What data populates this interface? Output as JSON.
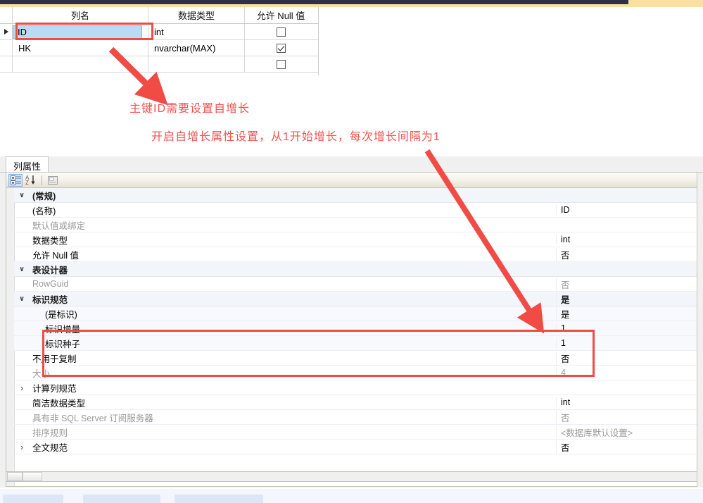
{
  "grid": {
    "headers": [
      "",
      "列名",
      "数据类型",
      "允许 Null 值"
    ],
    "rows": [
      {
        "marker": "▶",
        "name": "ID",
        "type": "int",
        "nullable": false,
        "selected": true
      },
      {
        "marker": "",
        "name": "HK",
        "type": "nvarchar(MAX)",
        "nullable": true,
        "selected": false
      },
      {
        "marker": "",
        "name": "",
        "type": "",
        "nullable": false,
        "selected": false
      }
    ]
  },
  "annotations": {
    "line1": "主键ID需要设置自增长",
    "line2": "开启自增长属性设置，从1开始增长，每次增长间隔为1",
    "color": "#f2534f",
    "box_color": "#f04b45"
  },
  "properties_panel": {
    "tab_label": "列属性",
    "toolbar": {
      "categorized_title": "按类别分组",
      "alphabetical_title": "字母序",
      "property_pages_title": "属性页"
    },
    "rows": [
      {
        "kind": "category",
        "expander": "down",
        "label": "(常规)",
        "value": ""
      },
      {
        "kind": "item",
        "expander": "",
        "label": "(名称)",
        "value": "ID"
      },
      {
        "kind": "item",
        "expander": "",
        "label": "默认值或绑定",
        "value": "",
        "dim": true
      },
      {
        "kind": "item",
        "expander": "",
        "label": "数据类型",
        "value": "int"
      },
      {
        "kind": "item",
        "expander": "",
        "label": "允许 Null 值",
        "value": "否"
      },
      {
        "kind": "category",
        "expander": "down",
        "label": "表设计器",
        "value": ""
      },
      {
        "kind": "item",
        "expander": "",
        "label": "RowGuid",
        "value": "否",
        "dim": true
      },
      {
        "kind": "category",
        "expander": "down",
        "label": "标识规范",
        "value": "是"
      },
      {
        "kind": "sub",
        "expander": "",
        "label": "(是标识)",
        "value": "是"
      },
      {
        "kind": "sub",
        "expander": "",
        "label": "标识增量",
        "value": "1"
      },
      {
        "kind": "sub",
        "expander": "",
        "label": "标识种子",
        "value": "1"
      },
      {
        "kind": "item",
        "expander": "",
        "label": "不用于复制",
        "value": "否"
      },
      {
        "kind": "item",
        "expander": "",
        "label": "大小",
        "value": "4",
        "dim": true
      },
      {
        "kind": "item",
        "expander": "right",
        "label": "计算列规范",
        "value": ""
      },
      {
        "kind": "item",
        "expander": "",
        "label": "简洁数据类型",
        "value": "int"
      },
      {
        "kind": "item",
        "expander": "",
        "label": "具有非 SQL Server 订阅服务器",
        "value": "否",
        "dim": true
      },
      {
        "kind": "item",
        "expander": "",
        "label": "排序规则",
        "value": "<数据库默认设置>",
        "dim": true
      },
      {
        "kind": "item",
        "expander": "right",
        "label": "全文规范",
        "value": "否"
      }
    ]
  }
}
